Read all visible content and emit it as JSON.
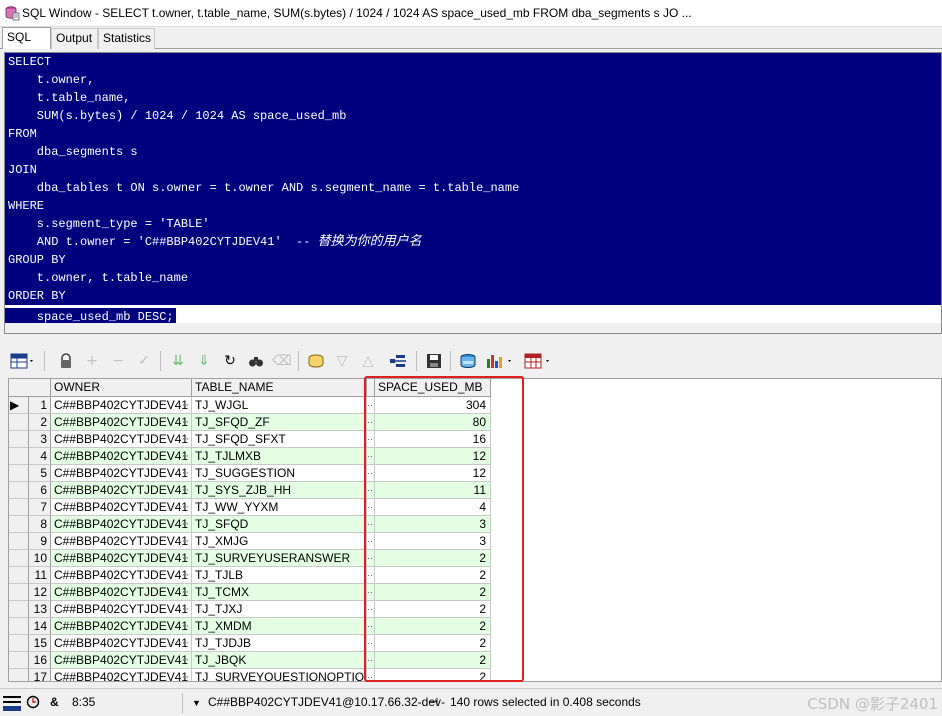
{
  "window": {
    "title": "SQL Window - SELECT t.owner, t.table_name, SUM(s.bytes) / 1024 / 1024 AS space_used_mb FROM dba_segments s JO ..."
  },
  "tabs": [
    {
      "label": "SQL",
      "active": true
    },
    {
      "label": "Output",
      "active": false
    },
    {
      "label": "Statistics",
      "active": false
    }
  ],
  "editor": {
    "lines": [
      "SELECT",
      "    t.owner,",
      "    t.table_name,",
      "    SUM(s.bytes) / 1024 / 1024 AS space_used_mb",
      "FROM",
      "    dba_segments s",
      "JOIN",
      "    dba_tables t ON s.owner = t.owner AND s.segment_name = t.table_name",
      "WHERE",
      "    s.segment_type = 'TABLE'",
      "    AND t.owner = 'C##BBP402CYTJDEV41'  -- ",
      "GROUP BY",
      "    t.owner, t.table_name",
      "ORDER BY",
      "    space_used_mb DESC;"
    ],
    "comment": "替换为你的用户名",
    "selection_color": "#00007f"
  },
  "toolbar": {
    "icons": [
      "grid-view-icon",
      "lock-icon",
      "add-record-icon",
      "delete-record-icon",
      "post-changes-icon",
      "fetch-next-icon",
      "fetch-last-icon",
      "refresh-icon",
      "find-icon",
      "clear-icon",
      "query-by-example-icon",
      "previous-icon",
      "next-icon",
      "export-icon",
      "save-icon",
      "connect-icon",
      "chart-icon",
      "table-options-icon"
    ]
  },
  "grid": {
    "columns": [
      "OWNER",
      "TABLE_NAME",
      "SPACE_USED_MB"
    ],
    "rows": [
      {
        "n": "1",
        "owner": "C##BBP402CYTJDEV41",
        "table": "TJ_WJGL",
        "mb": "304"
      },
      {
        "n": "2",
        "owner": "C##BBP402CYTJDEV41",
        "table": "TJ_SFQD_ZF",
        "mb": "80"
      },
      {
        "n": "3",
        "owner": "C##BBP402CYTJDEV41",
        "table": "TJ_SFQD_SFXT",
        "mb": "16"
      },
      {
        "n": "4",
        "owner": "C##BBP402CYTJDEV41",
        "table": "TJ_TJLMXB",
        "mb": "12"
      },
      {
        "n": "5",
        "owner": "C##BBP402CYTJDEV41",
        "table": "TJ_SUGGESTION",
        "mb": "12"
      },
      {
        "n": "6",
        "owner": "C##BBP402CYTJDEV41",
        "table": "TJ_SYS_ZJB_HH",
        "mb": "11"
      },
      {
        "n": "7",
        "owner": "C##BBP402CYTJDEV41",
        "table": "TJ_WW_YYXM",
        "mb": "4"
      },
      {
        "n": "8",
        "owner": "C##BBP402CYTJDEV41",
        "table": "TJ_SFQD",
        "mb": "3"
      },
      {
        "n": "9",
        "owner": "C##BBP402CYTJDEV41",
        "table": "TJ_XMJG",
        "mb": "3"
      },
      {
        "n": "10",
        "owner": "C##BBP402CYTJDEV41",
        "table": "TJ_SURVEYUSERANSWER",
        "mb": "2"
      },
      {
        "n": "11",
        "owner": "C##BBP402CYTJDEV41",
        "table": "TJ_TJLB",
        "mb": "2"
      },
      {
        "n": "12",
        "owner": "C##BBP402CYTJDEV41",
        "table": "TJ_TCMX",
        "mb": "2"
      },
      {
        "n": "13",
        "owner": "C##BBP402CYTJDEV41",
        "table": "TJ_TJXJ",
        "mb": "2"
      },
      {
        "n": "14",
        "owner": "C##BBP402CYTJDEV41",
        "table": "TJ_XMDM",
        "mb": "2"
      },
      {
        "n": "15",
        "owner": "C##BBP402CYTJDEV41",
        "table": "TJ_TJDJB",
        "mb": "2"
      },
      {
        "n": "16",
        "owner": "C##BBP402CYTJDEV41",
        "table": "TJ_JBQK",
        "mb": "2"
      },
      {
        "n": "17",
        "owner": "C##BBP402CYTJDEV41",
        "table": "TJ_SURVEYQUESTIONOPTION",
        "mb": "2"
      }
    ],
    "current_row_marker": "▶",
    "ellipsis": "···",
    "alt_row_color": "#e4ffe4"
  },
  "statusbar": {
    "time": "8:35",
    "amp": "&",
    "connection": "C##BBP402CYTJDEV41@10.17.66.32-dev-",
    "message": "140 rows selected in 0.408 seconds",
    "watermark": "CSDN @影子2401"
  }
}
